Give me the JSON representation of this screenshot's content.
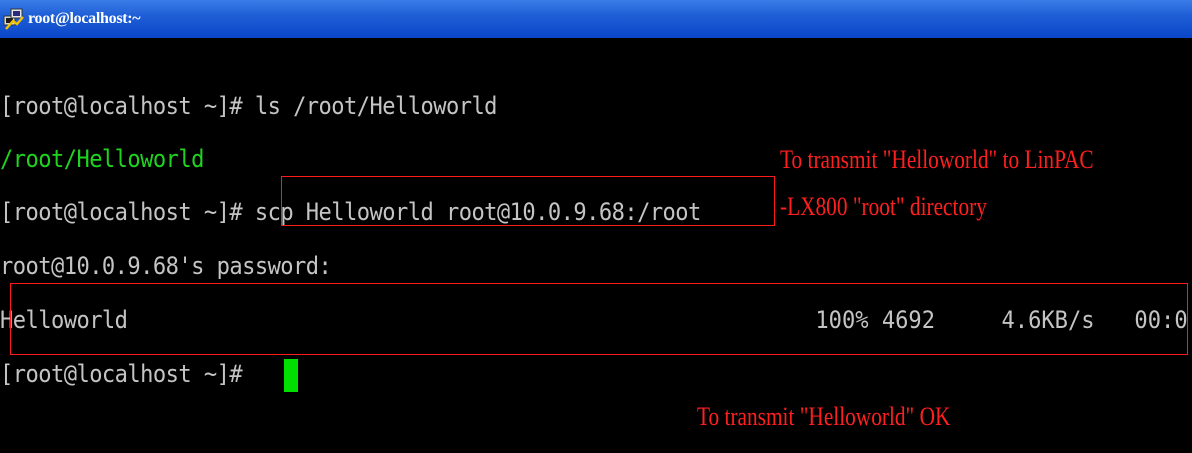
{
  "window": {
    "title": "root@localhost:~",
    "icon": "putty-terminal-icon"
  },
  "terminal": {
    "lines": [
      {
        "prompt": "[root@localhost ~]# ",
        "command": "ls /root/Helloworld"
      },
      {
        "output": "/root/Helloworld"
      },
      {
        "prompt": "[root@localhost ~]# ",
        "command": "scp Helloworld root@10.0.9.68:/root"
      },
      {
        "output": "root@10.0.9.68's password:"
      },
      {
        "file": "Helloworld",
        "percent": "100%",
        "size": "4692",
        "rate": "4.6KB/s",
        "eta": "00:0"
      },
      {
        "prompt": "[root@localhost ~]# "
      }
    ]
  },
  "annotations": {
    "scp_note_line1": "To transmit \"Helloworld\" to LinPAC",
    "scp_note_line2": "-LX800 \"root\" directory",
    "ok_note": "To transmit \"Helloworld\" OK",
    "color": "#ff1f1f"
  },
  "colors": {
    "terminal_bg": "#000000",
    "terminal_text": "#c4c4c4",
    "green_text": "#1fd41f",
    "cursor": "#00e000",
    "titlebar": "#0a46c9"
  }
}
